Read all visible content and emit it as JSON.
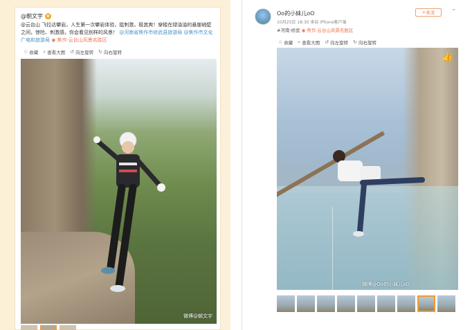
{
  "left_post": {
    "author": "@朝文宇",
    "badge": "V",
    "text_prefix": "@云台山 飞拉达攀岩，人生第一次攀岩体验，挺刺激，极其爽！穿梭在绿油油的悬崖峭壁之间，惊险、刺激感，你会看见别样的风景！",
    "link_1": "@河南省焦作市修武县旅游局",
    "link_2": "@焦作市文化广电和旅游局",
    "location": "焦作·云台山风景名胜区",
    "toolbar": {
      "collect": "收藏",
      "view_large": "查看大图",
      "rotate_left": "向左旋转",
      "rotate_right": "向右旋转"
    },
    "watermark": "微博@朝文宇"
  },
  "right_post": {
    "username": "Oo的小妹儿oO",
    "time": "10月25日 18:30",
    "source": "来自 iPhone客户端",
    "follow_label": "+关注",
    "tag_prefix": "#河南",
    "tag_city": "修武",
    "location": "焦作·云台山风景名胜区",
    "toolbar": {
      "collect": "收藏",
      "view_large": "查看大图",
      "rotate_left": "向左旋转",
      "rotate_right": "向右旋转"
    },
    "watermark": "微博@Oo的小妹儿oO"
  },
  "icons": {
    "collect": "star-icon",
    "view_large": "magnifier-icon",
    "rotate_left": "rotate-left-icon",
    "rotate_right": "rotate-right-icon",
    "like": "thumbs-up-icon",
    "chevron": "chevron-down-icon"
  },
  "colors": {
    "left_background": "#fdf0d8",
    "link": "#4a90c2",
    "location": "#eb7350",
    "accent": "#f39a2e"
  }
}
